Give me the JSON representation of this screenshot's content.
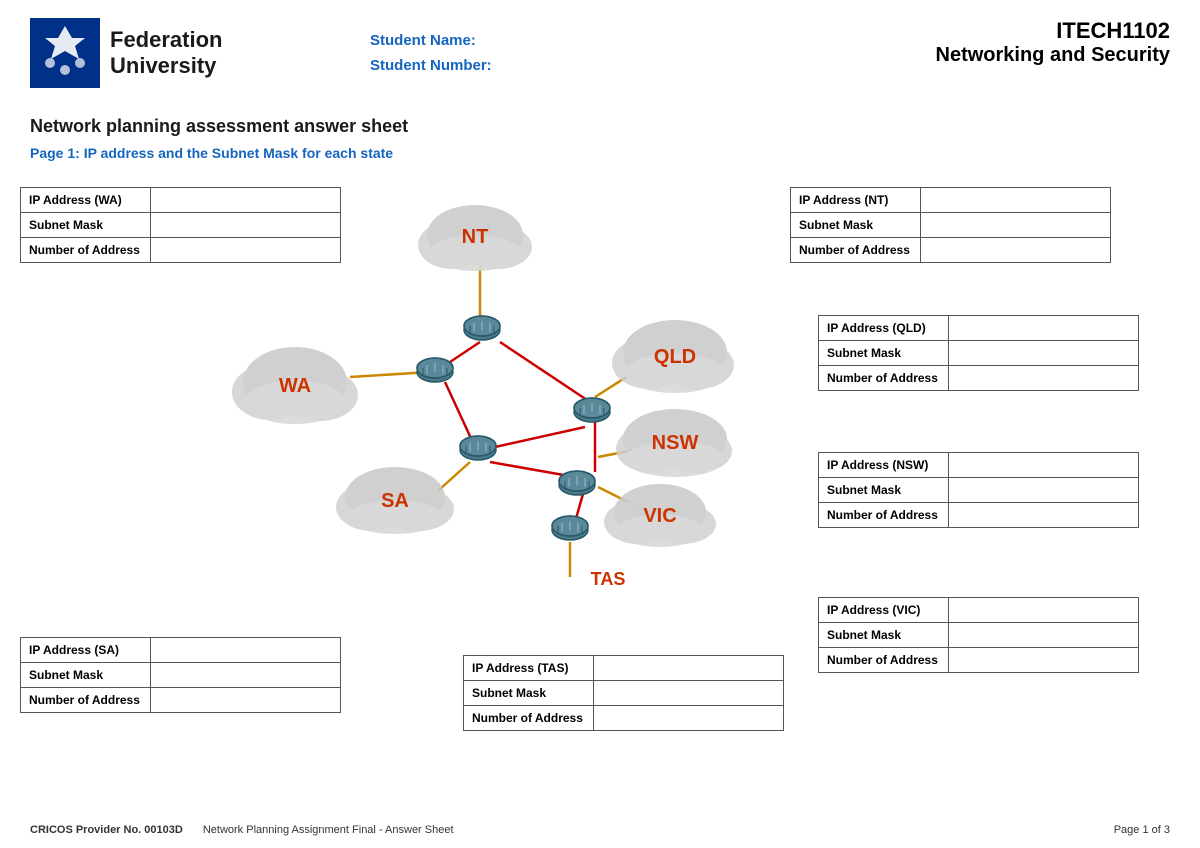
{
  "header": {
    "university_name_line1": "Federation",
    "university_name_line2": "University",
    "student_name_label": "Student Name:",
    "student_number_label": "Student Number:",
    "course_code": "ITECH1102",
    "course_name": "Networking and Security"
  },
  "page": {
    "main_title": "Network planning assessment answer sheet",
    "subtitle": "Page 1: IP address and the Subnet Mask for each state"
  },
  "tables": {
    "wa": {
      "label": "IP Address (WA)",
      "rows": [
        "IP Address (WA)",
        "Subnet Mask",
        "Number of Address"
      ]
    },
    "nt": {
      "rows": [
        "IP Address (NT)",
        "Subnet Mask",
        "Number of Address"
      ]
    },
    "sa": {
      "rows": [
        "IP Address (SA)",
        "Subnet Mask",
        "Number of Address"
      ]
    },
    "tas": {
      "rows": [
        "IP Address (TAS)",
        "Subnet Mask",
        "Number of Address"
      ]
    },
    "qld": {
      "rows": [
        "IP Address (QLD)",
        "Subnet Mask",
        "Number of Address"
      ]
    },
    "nsw": {
      "rows": [
        "IP Address (NSW)",
        "Subnet Mask",
        "Number of Address"
      ]
    },
    "vic": {
      "rows": [
        "IP Address (VIC)",
        "Subnet Mask",
        "Number of Address"
      ]
    }
  },
  "states": {
    "nt": "NT",
    "wa": "WA",
    "sa": "SA",
    "qld": "QLD",
    "nsw": "NSW",
    "vic": "VIC",
    "tas": "TAS"
  },
  "footer": {
    "cricos": "CRICOS Provider No. 00103D",
    "doc_name": "Network Planning Assignment Final - Answer Sheet",
    "page": "Page 1 of 3"
  }
}
